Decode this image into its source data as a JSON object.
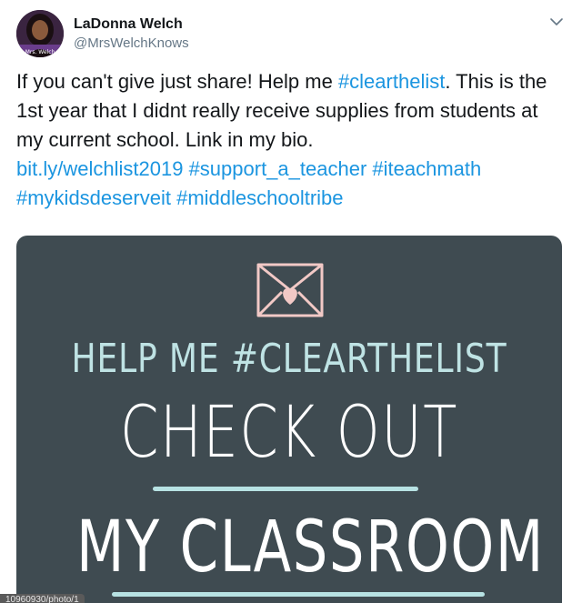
{
  "author": {
    "display_name": "LaDonna Welch",
    "handle": "@MrsWelchKnows",
    "avatar_caption": "Mrs. Welch"
  },
  "tweet": {
    "text_part1": "If you can't give just share! Help me ",
    "hashtag_clearthelist": "#clearthelist",
    "text_part2": ". This is the 1st year that I didnt really receive supplies from students at my current school. Link in my bio.",
    "link": "bit.ly/welchlist2019",
    "hashtag_support": "#support_a_teacher",
    "hashtag_iteachmath": "#iteachmath",
    "hashtag_mykids": "#mykidsdeserveit",
    "hashtag_middleschool": "#middleschooltribe"
  },
  "media": {
    "line1": "HELP ME #CLEARTHELIST",
    "line2": "CHECK OUT",
    "line3": "MY CLASSROOM",
    "background_color": "#3f4b51",
    "accent_color": "#b7e2e3",
    "envelope_color": "#f2c9c6",
    "icon": "envelope-heart-icon"
  },
  "status_bar": {
    "url_fragment": "10960930/photo/1"
  },
  "colors": {
    "link": "#1b95e0",
    "text": "#14171a",
    "secondary": "#657786"
  }
}
